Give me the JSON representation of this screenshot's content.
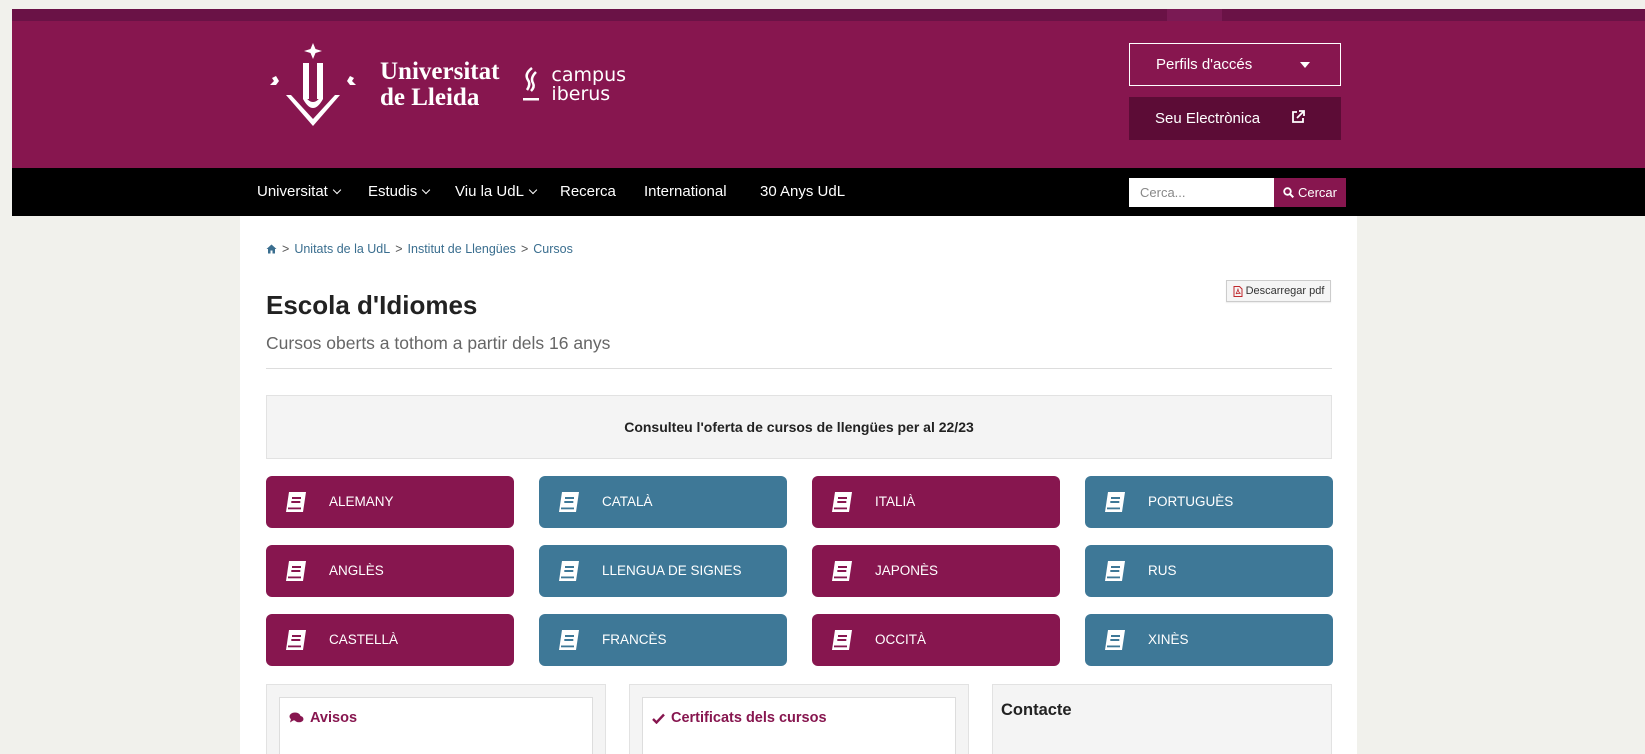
{
  "header": {
    "logo_line1": "Universitat",
    "logo_line2": "de Lleida",
    "campus_line1": "campus",
    "campus_line2": "iberus",
    "perfils_label": "Perfils d'accés",
    "seu_label": "Seu Electrònica"
  },
  "nav": {
    "items": [
      {
        "label": "Universitat",
        "dropdown": true
      },
      {
        "label": "Estudis",
        "dropdown": true
      },
      {
        "label": "Viu la UdL",
        "dropdown": true
      },
      {
        "label": "Recerca",
        "dropdown": false
      },
      {
        "label": "International",
        "dropdown": false
      },
      {
        "label": "30 Anys UdL",
        "dropdown": false
      }
    ],
    "search_placeholder": "Cerca...",
    "search_button": "Cercar"
  },
  "breadcrumb": {
    "home_icon": "home-icon",
    "items": [
      "Unitats de la UdL",
      "Institut de Llengües",
      "Cursos"
    ]
  },
  "page": {
    "pdf_label": "Descarregar pdf",
    "title": "Escola d'Idiomes",
    "subtitle": "Cursos oberts a tothom a partir dels 16 anys",
    "notice": "Consulteu l'oferta de cursos de llengües per al 22/23"
  },
  "languages": [
    {
      "label": "ALEMANY",
      "color": "#87164f"
    },
    {
      "label": "CATALÀ",
      "color": "#3e7897"
    },
    {
      "label": "ITALIÀ",
      "color": "#87164f"
    },
    {
      "label": "PORTUGUÈS",
      "color": "#3e7897"
    },
    {
      "label": "ANGLÈS",
      "color": "#87164f"
    },
    {
      "label": "LLENGUA DE SIGNES",
      "color": "#3e7897"
    },
    {
      "label": "JAPONÈS",
      "color": "#87164f"
    },
    {
      "label": "RUS",
      "color": "#3e7897"
    },
    {
      "label": "CASTELLÀ",
      "color": "#87164f"
    },
    {
      "label": "FRANCÈS",
      "color": "#3e7897"
    },
    {
      "label": "OCCITÀ",
      "color": "#87164f"
    },
    {
      "label": "XINÈS",
      "color": "#3e7897"
    }
  ],
  "panels": {
    "avisos": "Avisos",
    "certificats": "Certificats dels cursos",
    "contacte": "Contacte"
  },
  "colors": {
    "brand": "#87164f",
    "accent_blue": "#3e7897",
    "nav_bg": "#000000"
  }
}
